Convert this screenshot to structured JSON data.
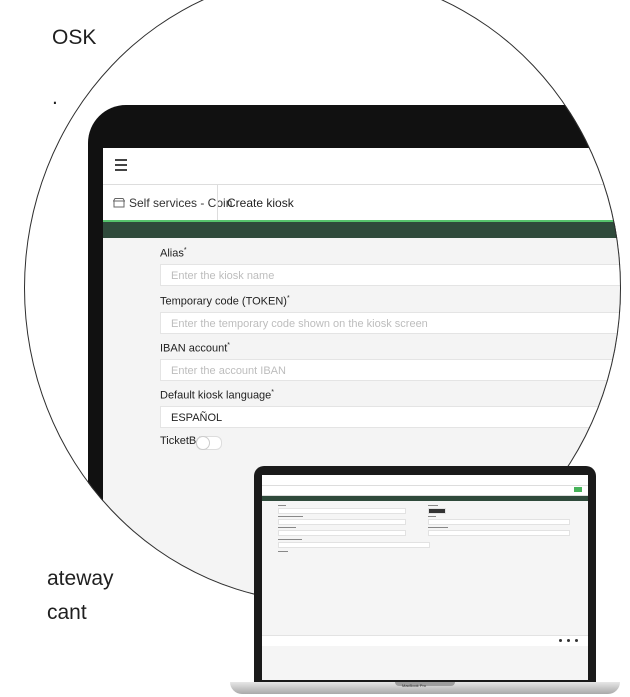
{
  "background": {
    "top_text_1": "OSK",
    "top_text_2": ".",
    "bottom_text_1": "ateway",
    "bottom_text_2": "cant"
  },
  "app": {
    "breadcrumb": {
      "section": "Self services - Coin",
      "section_icon": "store-icon",
      "current": "Create kiosk"
    },
    "form": {
      "alias": {
        "label": "Alias",
        "required": "*",
        "placeholder": "Enter the kiosk name"
      },
      "token": {
        "label": "Temporary code (TOKEN)",
        "required": "*",
        "placeholder": "Enter the temporary code shown on the kiosk screen"
      },
      "iban": {
        "label": "IBAN account",
        "required": "*",
        "placeholder": "Enter the account IBAN"
      },
      "language": {
        "label": "Default kiosk language",
        "required": "*",
        "value": "ESPAÑOL"
      },
      "ticketbai": {
        "label": "TicketBAI"
      }
    }
  },
  "device": {
    "label": "MacBook Pro"
  },
  "colors": {
    "header_dark": "#2f4a3b",
    "accent_green": "#56c36c"
  }
}
